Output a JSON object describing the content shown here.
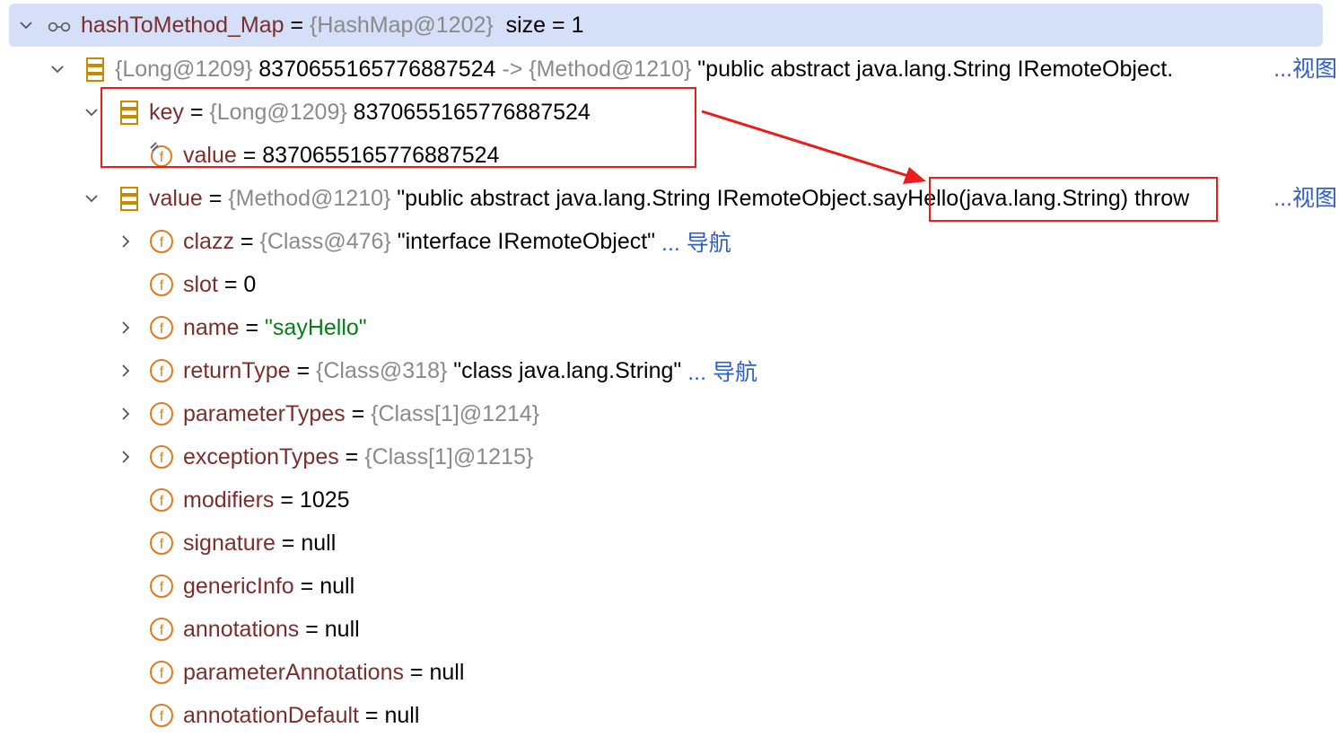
{
  "rows": [
    {
      "name": "hashToMethod_Map",
      "op": " = ",
      "ref": "{HashMap@1202}",
      "value": "  size = 1",
      "link": ""
    },
    {
      "name": "",
      "op": "",
      "ref": "{Long@1209}",
      "value": " 8370655165776887524 ",
      "ref2": "-> {Method@1210}",
      "value2": " \"public abstract java.lang.String IRemoteObject.",
      "link": "...视图"
    },
    {
      "name": "key",
      "op": " = ",
      "ref": "{Long@1209}",
      "value": " 8370655165776887524",
      "link": ""
    },
    {
      "name": "value",
      "op": " = ",
      "value": "8370655165776887524"
    },
    {
      "name": "value",
      "op": " = ",
      "ref": "{Method@1210}",
      "value": " \"public abstract java.lang.String IRemoteObject.",
      "highlight": "sayHello(java.lang.String)",
      "tail": " throw",
      "link": "...视图"
    },
    {
      "name": "clazz",
      "op": " = ",
      "ref": "{Class@476}",
      "value": " \"interface IRemoteObject\" ",
      "link": "... 导航"
    },
    {
      "name": "slot",
      "op": " = ",
      "value": "0"
    },
    {
      "name": "name",
      "op": " = ",
      "str": "\"sayHello\""
    },
    {
      "name": "returnType",
      "op": " = ",
      "ref": "{Class@318}",
      "value": " \"class java.lang.String\" ",
      "link": "... 导航"
    },
    {
      "name": "parameterTypes",
      "op": " = ",
      "ref": "{Class[1]@1214}"
    },
    {
      "name": "exceptionTypes",
      "op": " = ",
      "ref": "{Class[1]@1215}"
    },
    {
      "name": "modifiers",
      "op": " = ",
      "value": "1025"
    },
    {
      "name": "signature",
      "op": " = ",
      "value": "null"
    },
    {
      "name": "genericInfo",
      "op": " = ",
      "value": "null"
    },
    {
      "name": "annotations",
      "op": " = ",
      "value": "null"
    },
    {
      "name": "parameterAnnotations",
      "op": " = ",
      "value": "null"
    },
    {
      "name": "annotationDefault",
      "op": " = ",
      "value": "null"
    }
  ],
  "colors": {
    "selection": "#d5dff8",
    "field_name": "#7b2e2e",
    "reference": "#8a8a8a",
    "string": "#067d17",
    "link": "#2f5fc4",
    "field_icon": "#e07a1f",
    "entry_icon": "#c98a00",
    "annotation_red": "#ea1c1c"
  }
}
